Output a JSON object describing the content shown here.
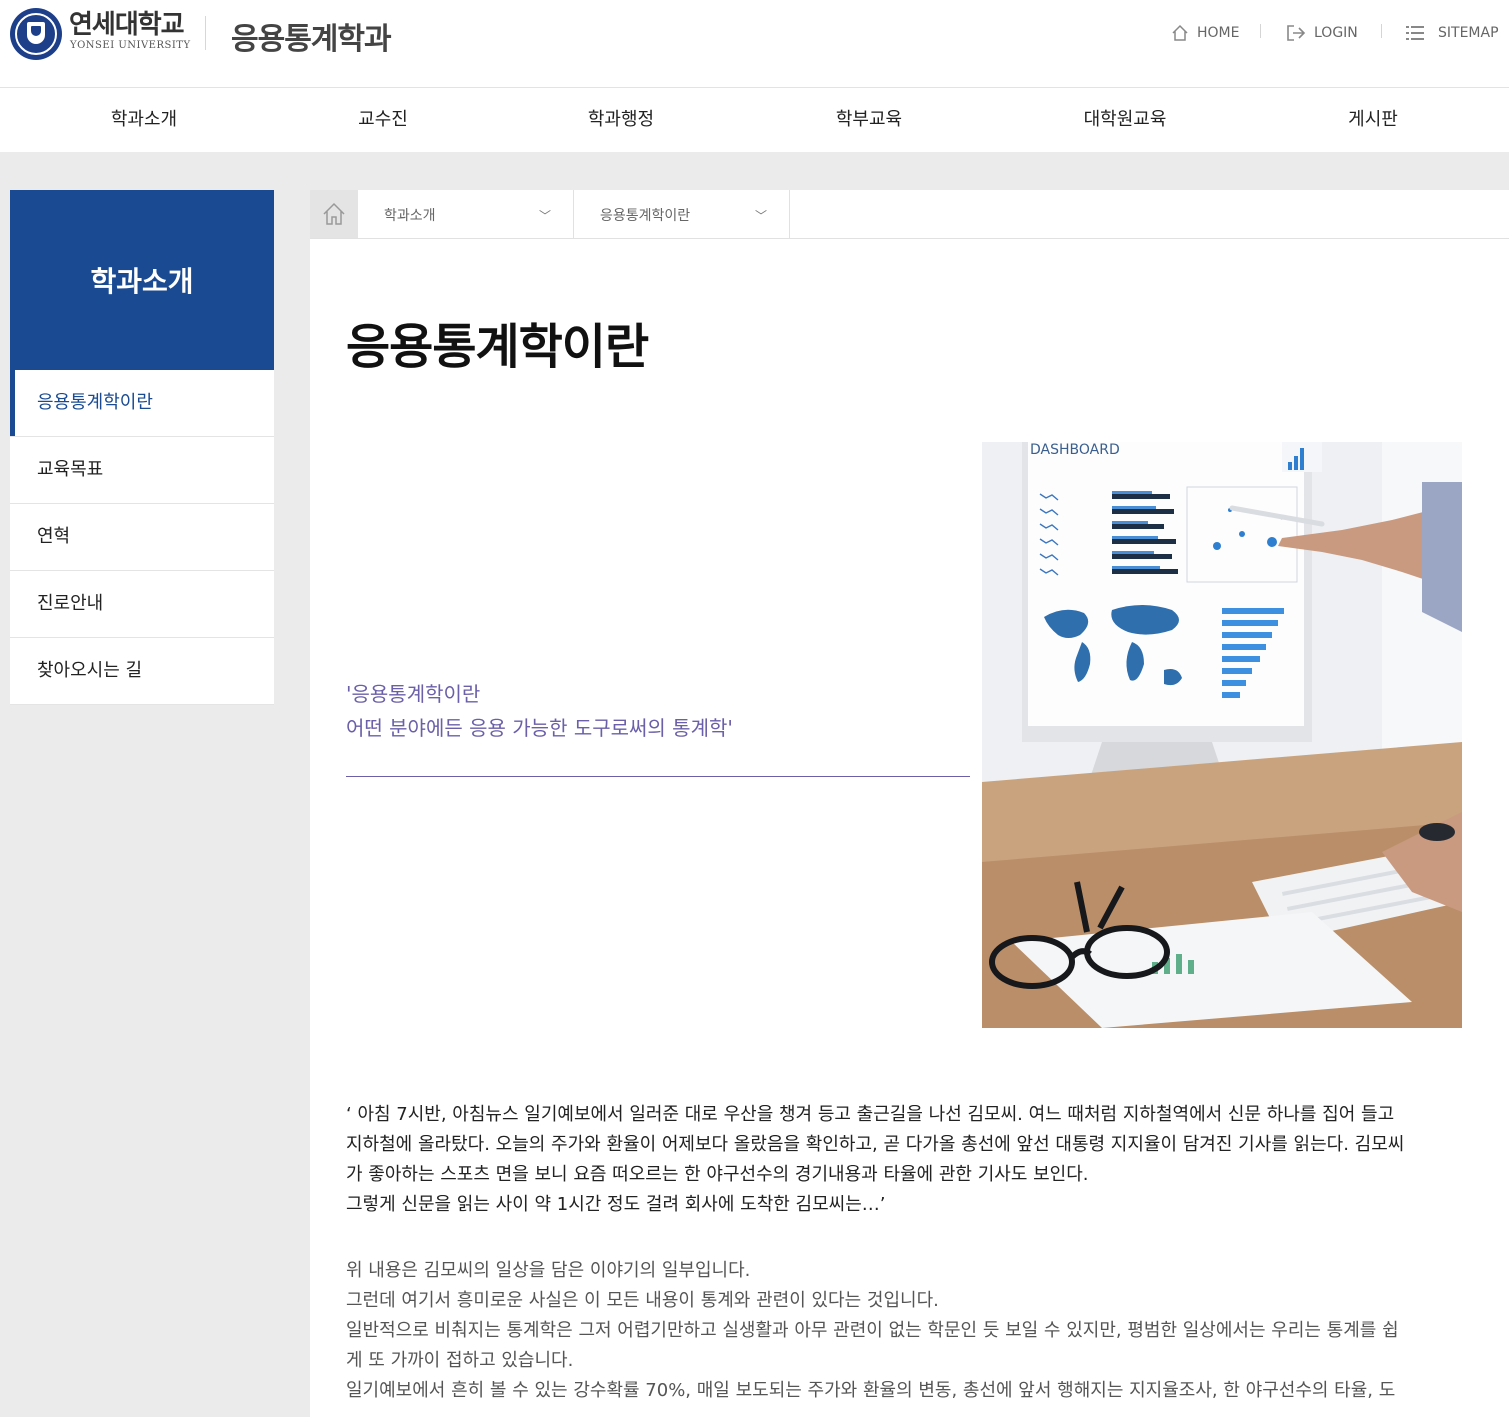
{
  "header": {
    "university_name": "연세대학교",
    "university_english": "YONSEI UNIVERSITY",
    "department_name": "응용통계학과",
    "util_links": [
      {
        "label": "HOME",
        "icon": "home-icon"
      },
      {
        "label": "LOGIN",
        "icon": "login-icon"
      },
      {
        "label": "SITEMAP",
        "icon": "list-icon"
      }
    ]
  },
  "gnb": {
    "items": [
      "학과소개",
      "교수진",
      "학과행정",
      "학부교육",
      "대학원교육",
      "게시판"
    ]
  },
  "sidebar": {
    "title": "학과소개",
    "items": [
      {
        "label": "응용통계학이란",
        "active": true
      },
      {
        "label": "교육목표",
        "active": false
      },
      {
        "label": "연혁",
        "active": false
      },
      {
        "label": "진로안내",
        "active": false
      },
      {
        "label": "찾아오시는 길",
        "active": false
      }
    ]
  },
  "breadcrumb": {
    "level1": "학과소개",
    "level2": "응용통계학이란"
  },
  "page": {
    "title": "응용통계학이란",
    "quote_line1": "'응용통계학이란",
    "quote_line2": "어떤 분야에든 응용 가능한 도구로써의 통계학'",
    "illustration_text": "DASHBOARD",
    "paragraph1": [
      "‘ 아침 7시반, 아침뉴스 일기예보에서 일러준 대로 우산을 챙겨 등고 출근길을 나선 김모씨. 여느 때처럼 지하철역에서 신문 하나를 집어 들고",
      "지하철에 올라탔다. 오늘의 주가와 환율이 어제보다 올랐음을 확인하고, 곧 다가올 총선에 앞선 대통령 지지율이 담겨진 기사를 읽는다. 김모씨",
      "가 좋아하는 스포츠 면을 보니 요즘 떠오르는 한 야구선수의 경기내용과 타율에 관한 기사도 보인다.",
      "그렇게 신문을 읽는 사이 약 1시간 정도 걸려 회사에 도착한 김모씨는…’"
    ],
    "paragraph2": [
      "위 내용은 김모씨의 일상을 담은 이야기의 일부입니다.",
      "그런데 여기서 흥미로운 사실은 이 모든 내용이 통계와 관련이 있다는 것입니다.",
      "일반적으로 비춰지는 통계학은 그저 어렵기만하고 실생활과 아무 관련이 없는 학문인 듯 보일 수 있지만, 평범한 일상에서는 우리는 통계를 쉽",
      "게 또 가까이 접하고 있습니다.",
      "일기예보에서 흔히 볼 수 있는 강수확률 70%, 매일 보도되는 주가와 환율의 변동, 총선에 앞서 행해지는 지지율조사, 한 야구선수의 타율, 도"
    ]
  },
  "colors": {
    "primary": "#1a4b92",
    "quote": "#6a5fa8",
    "background": "#ebebeb"
  }
}
